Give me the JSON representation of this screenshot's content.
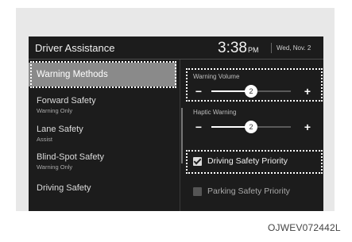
{
  "header": {
    "title": "Driver Assistance",
    "time": "3:38",
    "ampm": "PM",
    "date": "Wed, Nov. 2"
  },
  "menu": {
    "items": [
      {
        "label": "Warning Methods",
        "sub": "",
        "selected": true
      },
      {
        "label": "Forward Safety",
        "sub": "Warning Only",
        "selected": false
      },
      {
        "label": "Lane Safety",
        "sub": "Assist",
        "selected": false
      },
      {
        "label": "Blind-Spot Safety",
        "sub": "Warning Only",
        "selected": false
      },
      {
        "label": "Driving Safety",
        "sub": "",
        "selected": false
      }
    ]
  },
  "panel": {
    "warning_volume": {
      "label": "Warning Volume",
      "value": "2",
      "level": 0.5
    },
    "haptic_warning": {
      "label": "Haptic Warning",
      "value": "2",
      "level": 0.5
    },
    "minus": "−",
    "plus": "+",
    "options": [
      {
        "label": "Driving Safety Priority",
        "checked": true
      },
      {
        "label": "Parking Safety Priority",
        "checked": false
      }
    ]
  },
  "caption": "OJWEV072442L"
}
